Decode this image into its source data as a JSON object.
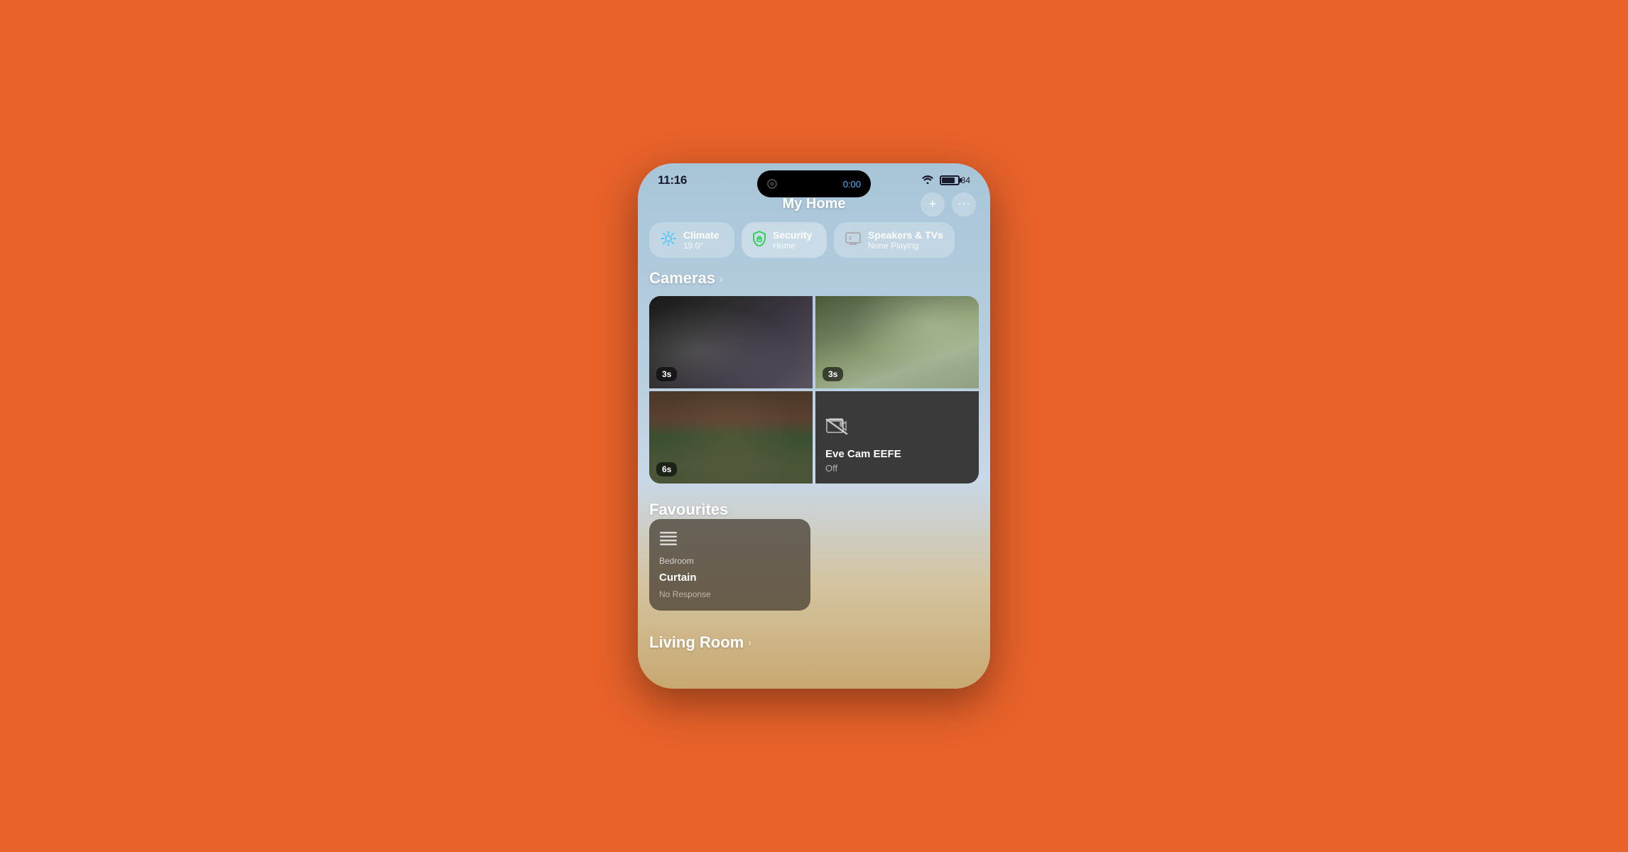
{
  "phone": {
    "status_bar": {
      "time": "11:16",
      "timer": "0:00",
      "battery_percent": "84"
    },
    "header": {
      "title": "My Home",
      "add_button": "+",
      "menu_button": "⋯"
    },
    "tabs": [
      {
        "id": "climate",
        "icon": "❄️",
        "label": "Climate",
        "sublabel": "19.0°",
        "active": false
      },
      {
        "id": "security",
        "icon": "🔒",
        "label": "Security",
        "sublabel": "Home",
        "active": true
      },
      {
        "id": "speakers",
        "icon": "📺",
        "label": "Speakers & TVs",
        "sublabel": "None Playing",
        "active": false
      }
    ],
    "cameras_section": {
      "title": "Cameras",
      "cameras": [
        {
          "id": "cam1",
          "position": "top-left",
          "badge": "3s"
        },
        {
          "id": "cam2",
          "position": "top-right",
          "badge": "3s"
        },
        {
          "id": "cam3",
          "position": "bottom-left",
          "badge": "6s"
        },
        {
          "id": "cam4",
          "position": "bottom-right",
          "name": "Eve Cam EEFE",
          "status": "Off"
        }
      ]
    },
    "favourites_section": {
      "title": "Favourites",
      "items": [
        {
          "id": "bedroom-curtain",
          "icon": "☰",
          "sublabel": "Bedroom",
          "label": "Curtain",
          "status": "No Response"
        }
      ]
    },
    "living_room_section": {
      "title": "Living Room"
    }
  }
}
